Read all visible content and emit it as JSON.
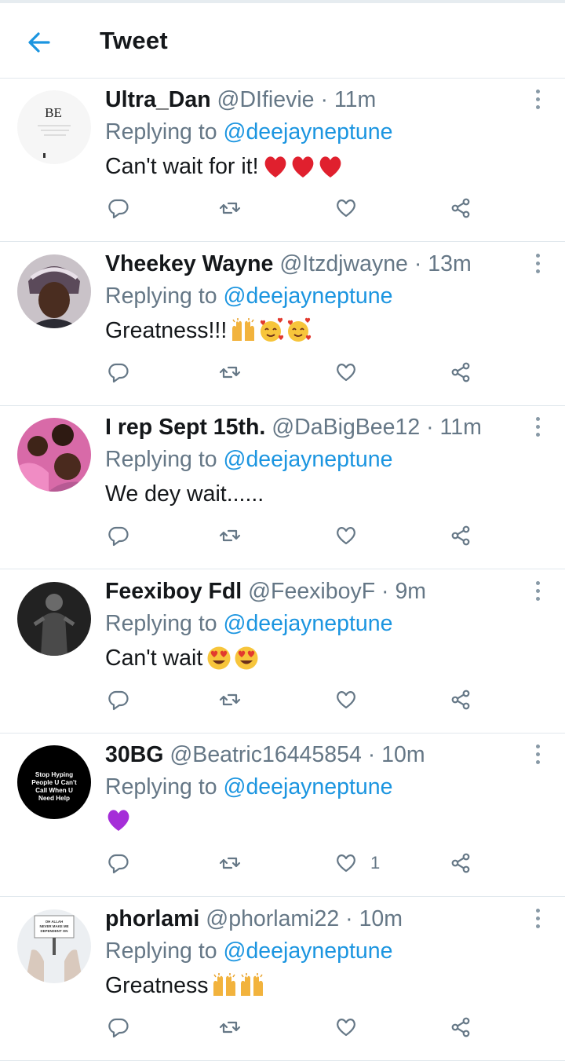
{
  "header": {
    "title": "Tweet",
    "back_icon": "arrow-left-icon",
    "accent": "#1b95e0"
  },
  "colors": {
    "name": "#14171a",
    "secondary": "#657786",
    "mention": "#1b95e0",
    "divider": "#e1e8ed",
    "icon": "#657786"
  },
  "tweets": [
    {
      "name": "Ultra_Dan",
      "handle": "@DIfievie",
      "sep": "·",
      "time": "11m",
      "reply_prefix": "Replying to ",
      "reply_to": "@deejayneptune",
      "text": "Can't wait for it!",
      "emojis": [
        "heart",
        "heart",
        "heart"
      ],
      "like_count": "",
      "avatar_text": "BE"
    },
    {
      "name": "Vheekey Wayne",
      "handle": "@Itzdjwayne",
      "sep": "·",
      "time": "13m",
      "reply_prefix": "Replying to ",
      "reply_to": "@deejayneptune",
      "text": "Greatness!!!",
      "emojis": [
        "raised-hands",
        "smiling-hearts",
        "smiling-hearts"
      ],
      "like_count": ""
    },
    {
      "name": "I rep Sept 15th.",
      "handle": "@DaBigBee12",
      "sep": "·",
      "time": "11m",
      "reply_prefix": "Replying to ",
      "reply_to": "@deejayneptune",
      "text": "We dey wait......",
      "emojis": [],
      "like_count": ""
    },
    {
      "name": "Feexiboy Fdl",
      "handle": "@FeexiboyF",
      "sep": "·",
      "time": "9m",
      "reply_prefix": "Replying to ",
      "reply_to": "@deejayneptune",
      "text": "Can't wait",
      "emojis": [
        "heart-eyes",
        "heart-eyes"
      ],
      "like_count": ""
    },
    {
      "name": "30BG",
      "handle": "@Beatric16445854",
      "sep": "·",
      "time": "10m",
      "reply_prefix": "Replying to ",
      "reply_to": "@deejayneptune",
      "text": "",
      "emojis": [
        "purple-heart"
      ],
      "like_count": "1",
      "avatar_text": "Stop Hyping People U Can't Call When U Need Help"
    },
    {
      "name": "phorlami",
      "handle": "@phorlami22",
      "sep": "·",
      "time": "10m",
      "reply_prefix": "Replying to ",
      "reply_to": "@deejayneptune",
      "text": "Greatness",
      "emojis": [
        "raised-hands",
        "raised-hands"
      ],
      "like_count": "",
      "avatar_text": "OH ALLAH NEVER MAKE ME DEPENDENT ON ANYONE EXCEPT YOU"
    }
  ],
  "action_icons": [
    "reply-icon",
    "retweet-icon",
    "like-icon",
    "share-icon"
  ]
}
